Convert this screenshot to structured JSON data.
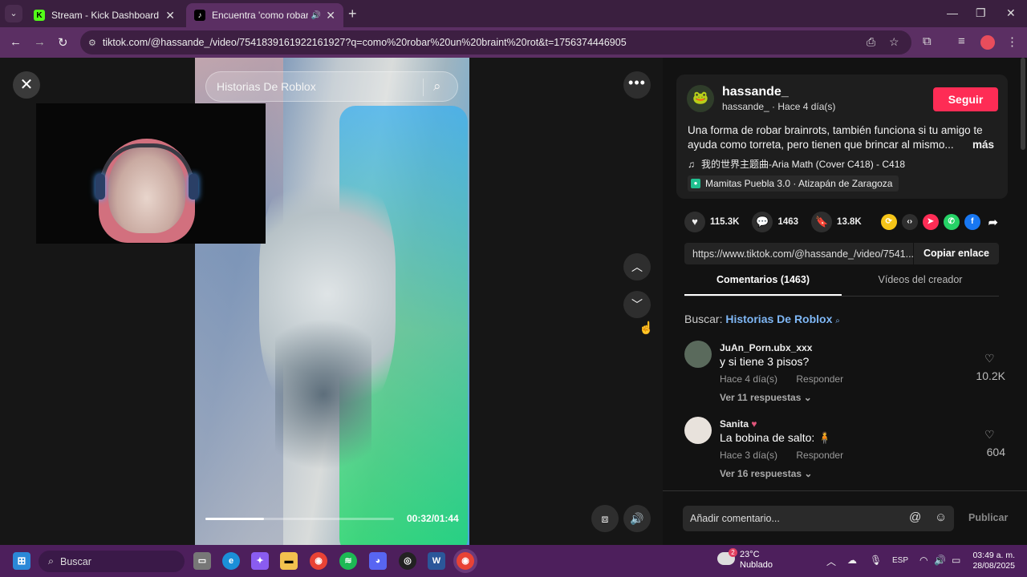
{
  "browser": {
    "tabs": [
      {
        "title": "Stream - Kick Dashboard",
        "favicon": "K"
      },
      {
        "title": "Encuentra 'como robar un l",
        "favicon": "♪"
      }
    ],
    "url": "tiktok.com/@hassande_/video/7541839161922161927?q=como%20robar%20un%20braint%20rot&t=1756374446905"
  },
  "video": {
    "search_placeholder": "Historias De Roblox",
    "time": "00:32/01:44",
    "progress": 0.31
  },
  "post": {
    "creator": "hassande_",
    "creator_sub": "hassande_ · Hace 4 día(s)",
    "follow_label": "Seguir",
    "description": "Una forma de robar brainrots, también funciona si tu amigo te ayuda como torreta, pero tienen que brincar al mismo...",
    "more_label": "más",
    "music": "我的世界主题曲-Aria Math (Cover C418) - C418",
    "location": "Mamitas Puebla 3.0 · Atizapán de Zaragoza",
    "likes": "115.3K",
    "comments": "1463",
    "saves": "13.8K",
    "link": "https://www.tiktok.com/@hassande_/video/7541...",
    "copy_label": "Copiar enlace"
  },
  "panel_tabs": {
    "comments": "Comentarios (1463)",
    "creator_videos": "Vídeos del creador"
  },
  "search_hint": {
    "prefix": "Buscar:",
    "term": "Historias De Roblox"
  },
  "comments": [
    {
      "user": "JuAn_Porn.ubx_xxx",
      "text": "y si tiene 3 pisos?",
      "time": "Hace 4 día(s)",
      "reply": "Responder",
      "likes": "10.2K",
      "more": "Ver 11 respuestas"
    },
    {
      "user": "Sanita",
      "text": "La bobina de salto:",
      "time": "Hace 3 día(s)",
      "reply": "Responder",
      "likes": "604",
      "more": "Ver 16 respuestas"
    }
  ],
  "comment_bar": {
    "placeholder": "Añadir comentario...",
    "publish": "Publicar"
  },
  "taskbar": {
    "search": "Buscar",
    "weather_temp": "23°C",
    "weather_desc": "Nublado",
    "weather_badge": "2",
    "lang": "ESP",
    "time": "03:49 a. m.",
    "date": "28/08/2025"
  },
  "colors": {
    "accent": "#fe2c55",
    "link": "#7fb7f5",
    "chrome": "#5b2f63"
  }
}
